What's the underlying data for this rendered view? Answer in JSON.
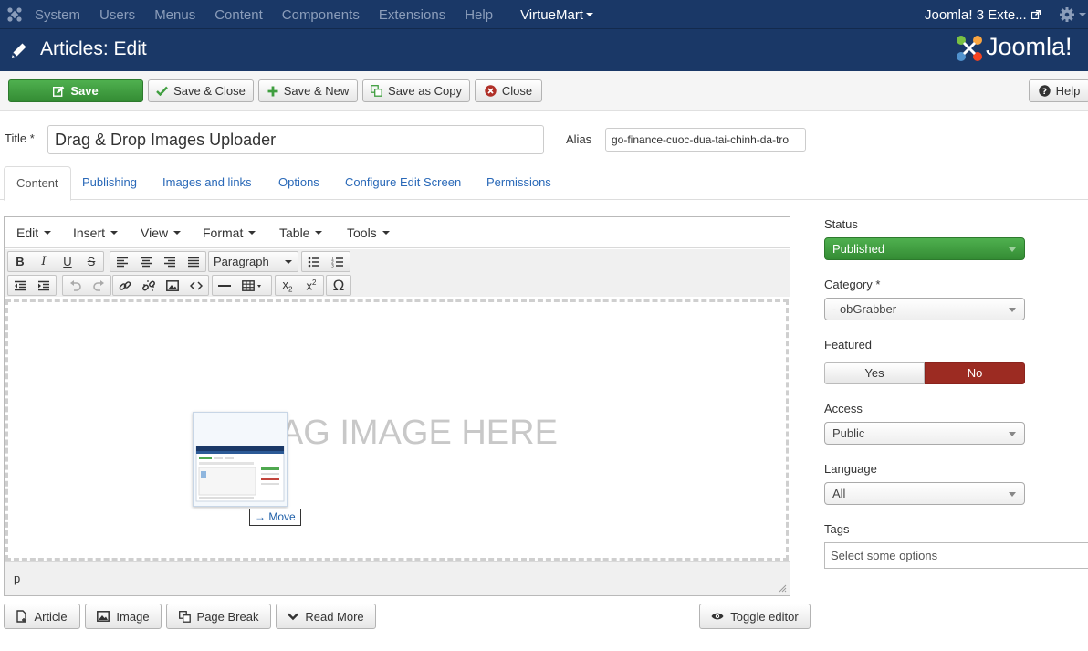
{
  "navbar": {
    "menu": [
      "System",
      "Users",
      "Menus",
      "Content",
      "Components",
      "Extensions",
      "Help"
    ],
    "virtuemart": "VirtueMart",
    "site_link": "Joomla! 3 Exte..."
  },
  "header": {
    "title": "Articles: Edit",
    "brand": "Joomla!"
  },
  "toolbar": {
    "save": "Save",
    "save_close": "Save & Close",
    "save_new": "Save & New",
    "save_copy": "Save as Copy",
    "close": "Close",
    "help": "Help"
  },
  "form": {
    "title_label": "Title",
    "required_mark": "*",
    "title_value": "Drag & Drop Images Uploader",
    "alias_label": "Alias",
    "alias_value": "go-finance-cuoc-dua-tai-chinh-da-tro"
  },
  "tabs": [
    "Content",
    "Publishing",
    "Images and links",
    "Options",
    "Configure Edit Screen",
    "Permissions"
  ],
  "editor": {
    "menus": [
      "Edit",
      "Insert",
      "View",
      "Format",
      "Table",
      "Tools"
    ],
    "format_select": "Paragraph",
    "drop_text": "DRAG IMAGE HERE",
    "move_tip": "Move",
    "path": "p"
  },
  "editor_buttons": {
    "article": "Article",
    "image": "Image",
    "page_break": "Page Break",
    "read_more": "Read More",
    "toggle_editor": "Toggle editor"
  },
  "sidebar": {
    "status_label": "Status",
    "status_value": "Published",
    "category_label": "Category",
    "category_value": "- obGrabber",
    "featured_label": "Featured",
    "featured_yes": "Yes",
    "featured_no": "No",
    "access_label": "Access",
    "access_value": "Public",
    "language_label": "Language",
    "language_value": "All",
    "tags_label": "Tags",
    "tags_placeholder": "Select some options"
  },
  "colors": {
    "header_bg": "#1a3867",
    "save_green": "#3f9e3f",
    "no_red": "#9c2b22",
    "link_blue": "#2a69b8"
  }
}
